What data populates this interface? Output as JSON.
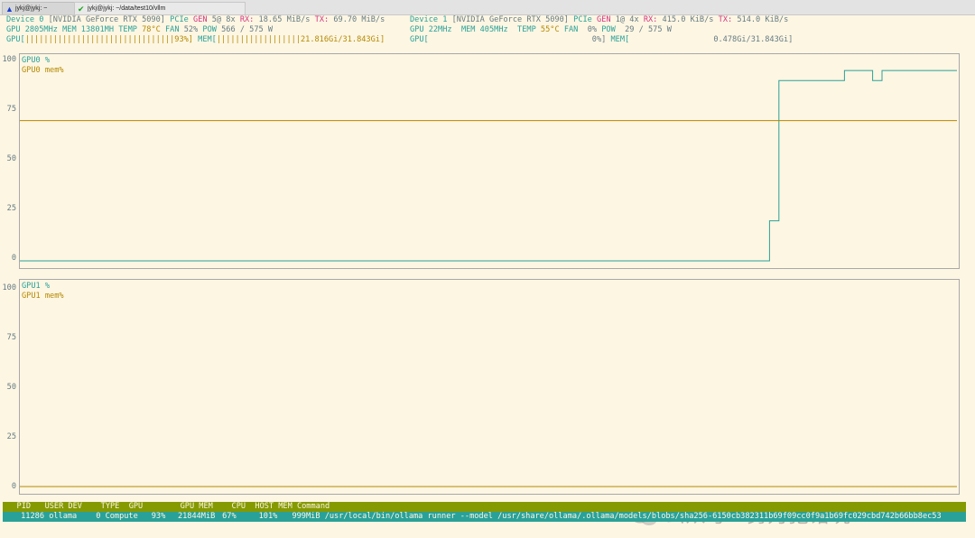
{
  "tabs": [
    {
      "label": "jykj@jykj: ~",
      "icon": "warning-icon"
    },
    {
      "label": "jykj@jykj: ~/data/test10/vllm",
      "icon": "check-icon"
    }
  ],
  "devices": [
    {
      "l1": {
        "device": "Device 0",
        "model": "[NVIDIA GeForce RTX 5090]",
        "pcie": "PCIe",
        "gen": "GEN",
        "gen_val": "5@ 8x",
        "rx": "RX:",
        "rx_val": "18.65 MiB/s",
        "tx": "TX:",
        "tx_val": "69.70 MiB/s"
      },
      "l2": {
        "gpu": "GPU 2805MHz",
        "mem": "MEM 13801MH",
        "temp": "TEMP",
        "temp_val": " 78°C",
        "fan": "FAN",
        "fan_val": " 52%",
        "pow": "POW",
        "pow_val": "566 / 575 W"
      },
      "l3": {
        "gpu_label": "GPU[",
        "gpu_bar": "||||||||||||||||||||||||||||||||93%]",
        "mem_label": "MEM[",
        "mem_bar": "||||||||||||||||||21.816Gi/31.843Gi]"
      }
    },
    {
      "l1": {
        "device": "Device 1",
        "model": "[NVIDIA GeForce RTX 5090]",
        "pcie": "PCIe",
        "gen": "GEN",
        "gen_val": "1@ 4x",
        "rx": "RX:",
        "rx_val": "415.0 KiB/s",
        "tx": "TX:",
        "tx_val": "514.0 KiB/s"
      },
      "l2": {
        "gpu": "GPU 22MHz ",
        "mem": "MEM 405MHz ",
        "temp": "TEMP",
        "temp_val": " 55°C",
        "fan": "FAN",
        "fan_val": "  0%",
        "pow": "POW",
        "pow_val": " 29 / 575 W"
      },
      "l3": {
        "gpu_label": "GPU[",
        "gpu_bar": "                                   0%]",
        "mem_label": "MEM[",
        "mem_bar": "                  0.478Gi/31.843Gi]"
      }
    }
  ],
  "charts": {
    "gpu0": {
      "legend_pct": "GPU0 %",
      "legend_mem": "GPU0 mem%",
      "yticks": [
        "100",
        "75",
        "50",
        "25",
        "0"
      ]
    },
    "gpu1": {
      "legend_pct": "GPU1 %",
      "legend_mem": "GPU1 mem%",
      "yticks": [
        "100",
        "75",
        "50",
        "25",
        "0"
      ]
    }
  },
  "chart_data": [
    {
      "type": "line",
      "ylim": [
        0,
        100
      ],
      "series": [
        {
          "name": "GPU0 %",
          "color": "#2aa198",
          "x": [
            0,
            0.8,
            0.8,
            0.81,
            0.81,
            0.88,
            0.88,
            0.91,
            0.91,
            0.92,
            0.92,
            1.0
          ],
          "y": [
            0,
            0,
            20,
            20,
            90,
            90,
            95,
            95,
            90,
            90,
            95,
            95
          ]
        },
        {
          "name": "GPU0 mem%",
          "color": "#b58900",
          "x": [
            0,
            1.0
          ],
          "y": [
            70,
            70
          ]
        }
      ]
    },
    {
      "type": "line",
      "ylim": [
        0,
        100
      ],
      "series": [
        {
          "name": "GPU1 %",
          "color": "#2aa198",
          "x": [
            0,
            1.0
          ],
          "y": [
            0,
            0
          ]
        },
        {
          "name": "GPU1 mem%",
          "color": "#b58900",
          "x": [
            0,
            1.0
          ],
          "y": [
            0,
            0
          ]
        }
      ]
    }
  ],
  "process_header": "   PID   USER DEV    TYPE  GPU        GPU MEM    CPU  HOST MEM Command",
  "process_row": {
    "pid": "11286",
    "user": "ollama",
    "dev": "0",
    "type": "Compute",
    "gpu": "93%",
    "gpu_mem": "21844MiB",
    "gpu_mem_pct": "67%",
    "cpu": "101%",
    "host_mem": "999MiB",
    "command": "/usr/local/bin/ollama runner --model /usr/share/ollama/.ollama/models/blobs/sha256-6150cb382311b69f09cc0f9a1b69fc029cbd742b66bb8ec53"
  },
  "watermark": "公众号 · 努力犯错玩AI"
}
